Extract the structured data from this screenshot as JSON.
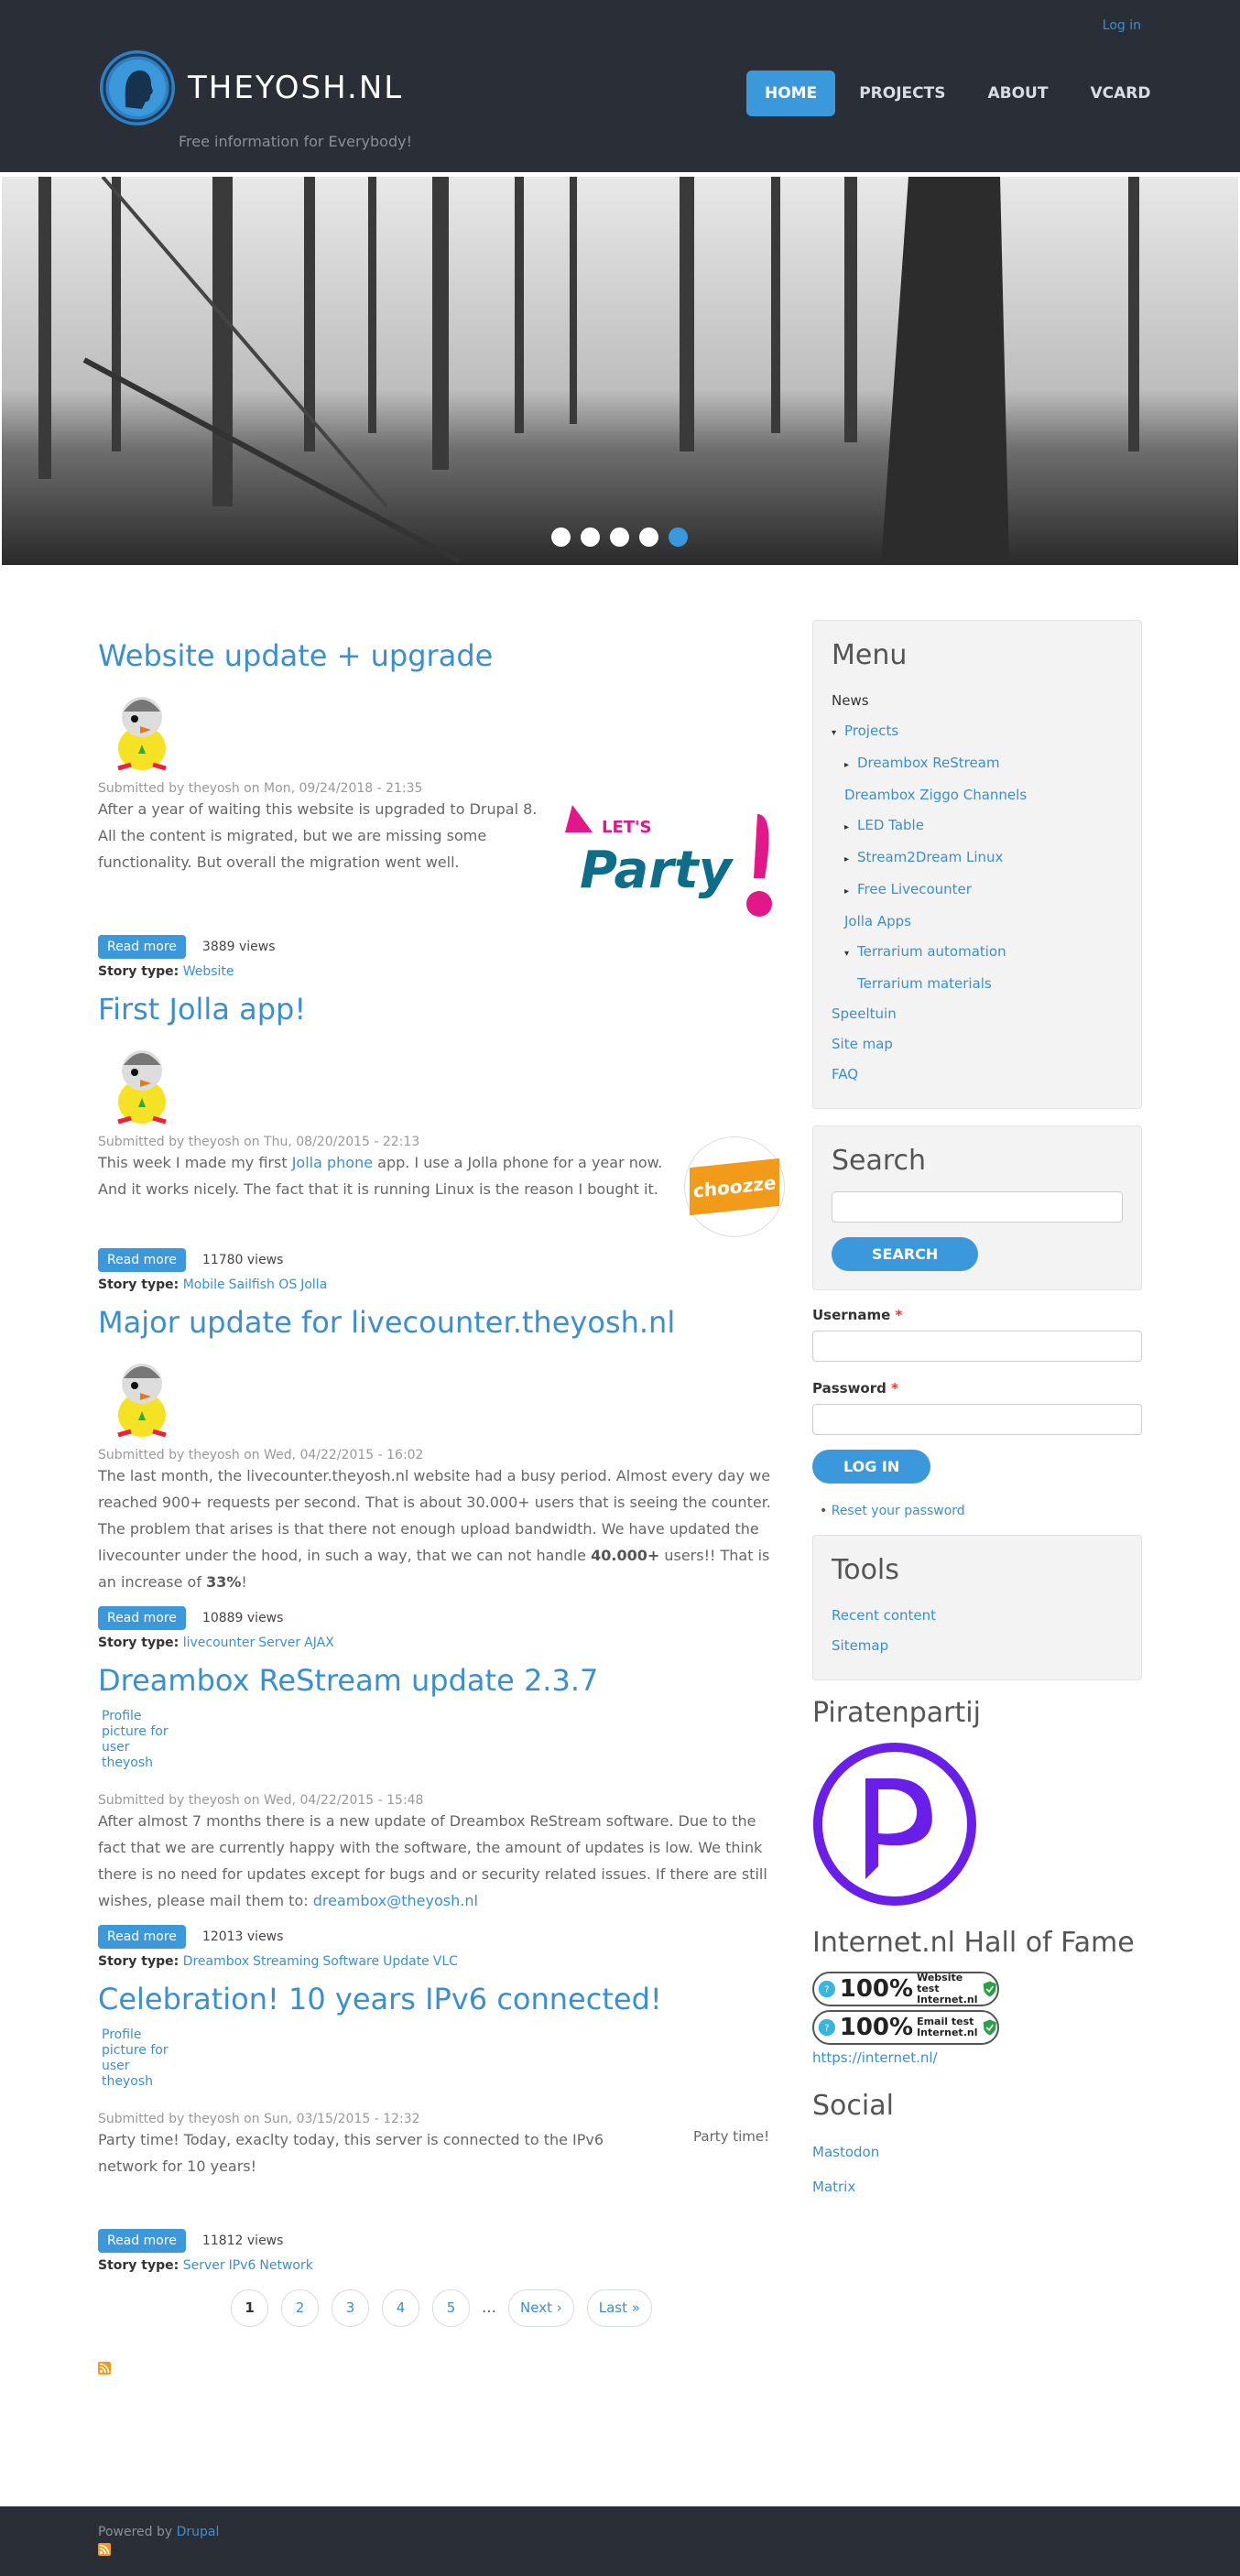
{
  "header": {
    "login": "Log in",
    "site_name": "THEYOSH.NL",
    "slogan": "Free information for Everybody!",
    "nav": [
      {
        "label": "HOME"
      },
      {
        "label": "PROJECTS"
      },
      {
        "label": "ABOUT"
      },
      {
        "label": "VCARD"
      }
    ],
    "accent": "#3a98db"
  },
  "slider": {
    "dots": 5,
    "active": 5
  },
  "nodes": [
    {
      "title": "Website update + upgrade",
      "submitted": "Submitted by theyosh on Mon, 09/24/2018 - 21:35",
      "body": "After a year of waiting this website is upgraded to Drupal 8. All the content is migrated, but we are missing some functionality. But overall the migration went well.",
      "read_more": "Read more",
      "views": "3889 views",
      "story_type_label": "Story type:",
      "tags": [
        "Website"
      ]
    },
    {
      "title": "First Jolla app!",
      "submitted": "Submitted by theyosh on Thu, 08/20/2015 - 22:13",
      "body_before": "This week I made my first ",
      "body_link": "Jolla phone",
      "body_after": "  app. I use a Jolla phone for a year now. And it works nicely. The fact that it is running Linux is the reason I bought it.",
      "thumb_text": "choozze",
      "read_more": "Read more",
      "views": "11780 views",
      "story_type_label": "Story type:",
      "tags": [
        "Mobile",
        "Sailfish OS",
        "Jolla"
      ]
    },
    {
      "title": "Major update for livecounter.theyosh.nl",
      "submitted": "Submitted by theyosh on Wed, 04/22/2015 - 16:02",
      "body_before": "The last month, the livecounter.theyosh.nl website had a busy period. Almost every day we reached 900+ requests per second. That is about 30.000+ users that is seeing the counter. The problem that arises is that there not enough upload bandwidth. We have updated the livecounter under the hood, in such a way, that we can not handle ",
      "body_bold": "40.000+",
      "body_mid": " users!! That is an increase of ",
      "body_bold2": "33%",
      "body_end": "!",
      "read_more": "Read more",
      "views": "10889 views",
      "story_type_label": "Story type:",
      "tags": [
        "livecounter",
        "Server",
        "AJAX"
      ]
    },
    {
      "title": "Dreambox ReStream update 2.3.7",
      "profile_alt": "Profile picture for user theyosh",
      "submitted": "Submitted by theyosh on Wed, 04/22/2015 - 15:48",
      "body_before": "After almost 7 months there is a new update of Dreambox ReStream software. Due to the fact that we are currently happy with the software, the amount of updates is low. We think there is no need for updates except for bugs and or security related issues. If there are still wishes, please mail them to: ",
      "body_link": "dreambox@theyosh.nl",
      "read_more": "Read more",
      "views": "12013 views",
      "story_type_label": "Story type:",
      "tags": [
        "Dreambox",
        "Streaming",
        "Software",
        "Update",
        "VLC"
      ]
    },
    {
      "title": "Celebration! 10 years IPv6 connected!",
      "profile_alt": "Profile picture for user theyosh",
      "submitted": "Submitted by theyosh on Sun, 03/15/2015 - 12:32",
      "body": "Party time! Today, exaclty today, this server is connected to the IPv6 network for 10 years!",
      "thumb_alt": "Party time!",
      "read_more": "Read more",
      "views": "11812 views",
      "story_type_label": "Story type:",
      "tags": [
        "Server",
        "IPv6",
        "Network"
      ]
    }
  ],
  "pager": {
    "pages": [
      "1",
      "2",
      "3",
      "4",
      "5"
    ],
    "ellipsis": "…",
    "next": "Next ›",
    "last": "Last »"
  },
  "menu": {
    "title": "Menu",
    "items": [
      {
        "label": "News",
        "level": 0,
        "caret": "",
        "plain": true
      },
      {
        "label": "Projects",
        "level": 0,
        "caret": "▾"
      },
      {
        "label": "Dreambox ReStream",
        "level": 1,
        "caret": "▸"
      },
      {
        "label": "Dreambox Ziggo Channels",
        "level": 1,
        "caret": ""
      },
      {
        "label": "LED Table",
        "level": 1,
        "caret": "▸"
      },
      {
        "label": "Stream2Dream Linux",
        "level": 1,
        "caret": "▸"
      },
      {
        "label": "Free Livecounter",
        "level": 1,
        "caret": "▸"
      },
      {
        "label": "Jolla Apps",
        "level": 1,
        "caret": ""
      },
      {
        "label": "Terrarium automation",
        "level": 1,
        "caret": "▾"
      },
      {
        "label": "Terrarium materials",
        "level": 2,
        "caret": ""
      },
      {
        "label": "Speeltuin",
        "level": 0,
        "caret": ""
      },
      {
        "label": "Site map",
        "level": 0,
        "caret": ""
      },
      {
        "label": "FAQ",
        "level": 0,
        "caret": ""
      }
    ]
  },
  "search": {
    "title": "Search",
    "button": "SEARCH"
  },
  "login_form": {
    "username": "Username",
    "password": "Password",
    "required": "*",
    "button": "LOG IN",
    "reset": "Reset your password"
  },
  "tools": {
    "title": "Tools",
    "items": [
      "Recent content",
      "Sitemap"
    ]
  },
  "piraten": {
    "title": "Piratenpartij",
    "color": "#6a1fe8"
  },
  "halloffame": {
    "title": "Internet.nl Hall of Fame",
    "badges": [
      {
        "pct": "100%",
        "line1": "Website test",
        "line2": "Internet.nl"
      },
      {
        "pct": "100%",
        "line1": "Email test",
        "line2": "Internet.nl"
      }
    ],
    "link": "https://internet.nl/"
  },
  "social": {
    "title": "Social",
    "items": [
      "Mastodon",
      "Matrix"
    ]
  },
  "footer": {
    "powered_by": "Powered by",
    "drupal": "Drupal"
  }
}
